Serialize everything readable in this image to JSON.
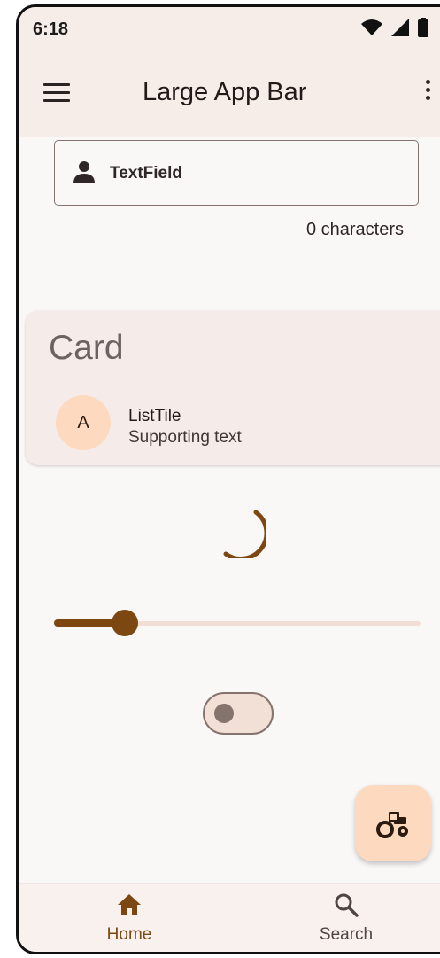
{
  "status_bar": {
    "time": "6:18",
    "icons": [
      "wifi-icon",
      "signal-icon",
      "battery-icon"
    ]
  },
  "app_bar": {
    "title": "Large App Bar",
    "leading_icon": "menu-icon",
    "trailing_icon": "more-vert-icon"
  },
  "text_field": {
    "label": "TextField",
    "icon": "person-icon",
    "counter": "0 characters"
  },
  "card": {
    "title": "Card",
    "list_tile": {
      "avatar_letter": "A",
      "title": "ListTile",
      "subtitle": "Supporting text"
    }
  },
  "progress": {
    "type": "circular-indeterminate"
  },
  "slider": {
    "value": 0.1
  },
  "switch": {
    "on": false
  },
  "fab": {
    "icon": "tractor-icon"
  },
  "nav": {
    "items": [
      {
        "label": "Home",
        "icon": "home-icon",
        "selected": true
      },
      {
        "label": "Search",
        "icon": "search-icon",
        "selected": false
      }
    ]
  },
  "colors": {
    "primary": "#7d4712",
    "surface": "#faf8f7",
    "app_bar": "#f6ece8",
    "primary_container": "#fdd9bf",
    "outline": "#85736d"
  }
}
